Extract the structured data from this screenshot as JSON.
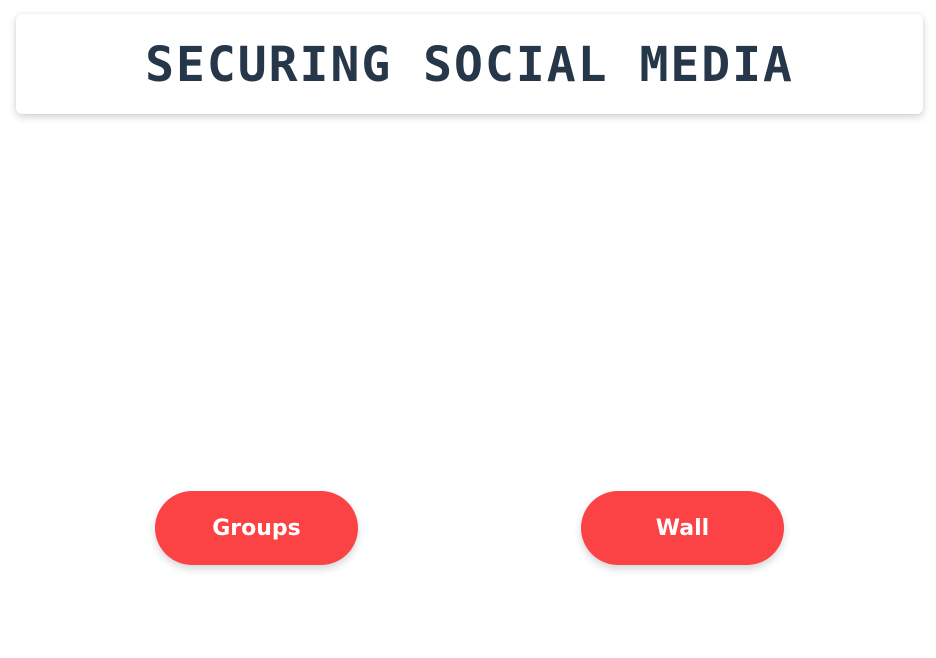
{
  "header": {
    "title": "SECURING SOCIAL MEDIA"
  },
  "actions": {
    "groups_label": "Groups",
    "wall_label": "Wall"
  },
  "colors": {
    "title_text": "#27374a",
    "button_background": "#fb4245",
    "button_text": "#ffffff",
    "page_background": "#ffffff"
  }
}
